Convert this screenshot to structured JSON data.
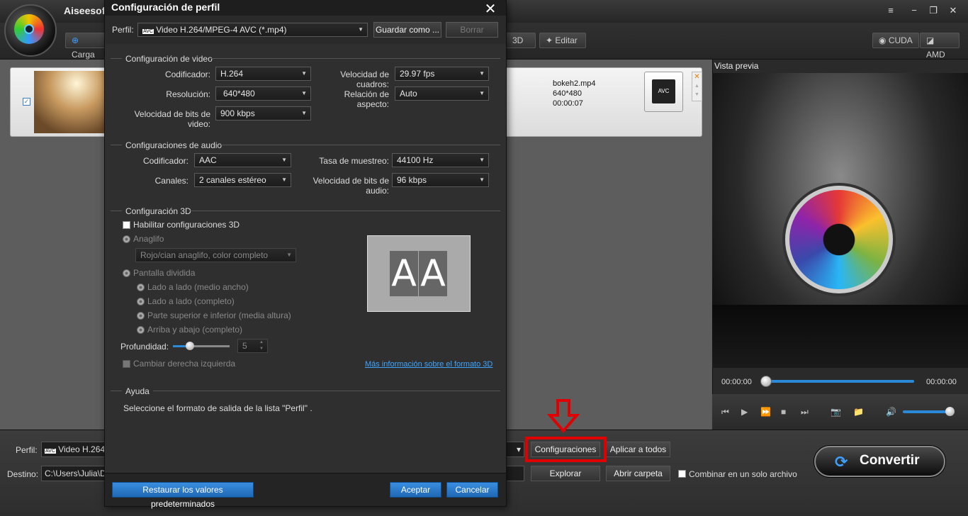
{
  "app": {
    "title": "Aiseesof"
  },
  "window": {
    "menu_icon": "≡",
    "minimize": "−",
    "restore": "❐",
    "close": "✕"
  },
  "toolbar": {
    "add_file": "Carga",
    "three_d": "3D",
    "edit": "Editar",
    "cuda": "CUDA",
    "amd": "AMD"
  },
  "file": {
    "name": "bokeh2.mp4",
    "resolution": "640*480",
    "duration": "00:00:07",
    "format_icon": "AVC"
  },
  "preview": {
    "label": "Vista previa",
    "time_start": "00:00:00",
    "time_end": "00:00:00",
    "seek_fraction": 0,
    "volume_fraction": 0.9
  },
  "bottom": {
    "profile_label": "Perfil:",
    "profile_value": "Video H.264/",
    "dest_label": "Destino:",
    "dest_value": "C:\\Users\\Julia\\Do",
    "settings_btn": "Configuraciones",
    "apply_all_btn": "Aplicar a todos",
    "browse_btn": "Explorar",
    "open_folder_btn": "Abrir carpeta",
    "merge_label": "Combinar en un solo archivo",
    "convert_btn": "Convertir"
  },
  "dialog": {
    "title": "Configuración de perfil",
    "profile_label": "Perfil:",
    "profile_value": "Video H.264/MPEG-4 AVC (*.mp4)",
    "save_as": "Guardar como ...",
    "delete": "Borrar",
    "video_section": "Configuración de video",
    "video": {
      "encoder_label": "Codificador:",
      "encoder": "H.264",
      "framerate_label": "Velocidad de cuadros:",
      "framerate": "29.97 fps",
      "resolution_label": "Resolución:",
      "resolution": "640*480",
      "aspect_label": "Relación de aspecto:",
      "aspect": "Auto",
      "bitrate_label": "Velocidad de bits de video:",
      "bitrate": "900 kbps"
    },
    "audio_section": "Configuraciones de audio",
    "audio": {
      "encoder_label": "Codificador:",
      "encoder": "AAC",
      "samplerate_label": "Tasa de muestreo:",
      "samplerate": "44100 Hz",
      "channels_label": "Canales:",
      "channels": "2 canales estéreo",
      "bitrate_label": "Velocidad de bits de audio:",
      "bitrate": "96 kbps"
    },
    "three_d_section": "Configuración 3D",
    "three_d": {
      "enable": "Habilitar configuraciones 3D",
      "anaglyph": "Anaglifo",
      "anaglyph_value": "Rojo/cian anaglifo, color completo",
      "split": "Pantalla dividida",
      "side_half": "Lado a lado (medio ancho)",
      "side_full": "Lado a lado (completo)",
      "top_half": "Parte superior e inferior (media altura)",
      "top_full": "Arriba y abajo (completo)",
      "depth_label": "Profundidad:",
      "depth_value": "5",
      "swap": "Cambiar derecha izquierda",
      "info_link": "Más información sobre el formato 3D",
      "preview_left": "A",
      "preview_right": "A"
    },
    "help_section": "Ayuda",
    "help_text": "Seleccione el formato de salida de la lista \"Perfil\" .",
    "restore_btn": "Restaurar los valores predeterminados",
    "ok_btn": "Aceptar",
    "cancel_btn": "Cancelar"
  },
  "colors": {
    "accent_blue": "#2a8ad8",
    "highlight_red": "#e00000",
    "link_blue": "#3ea6ff"
  }
}
